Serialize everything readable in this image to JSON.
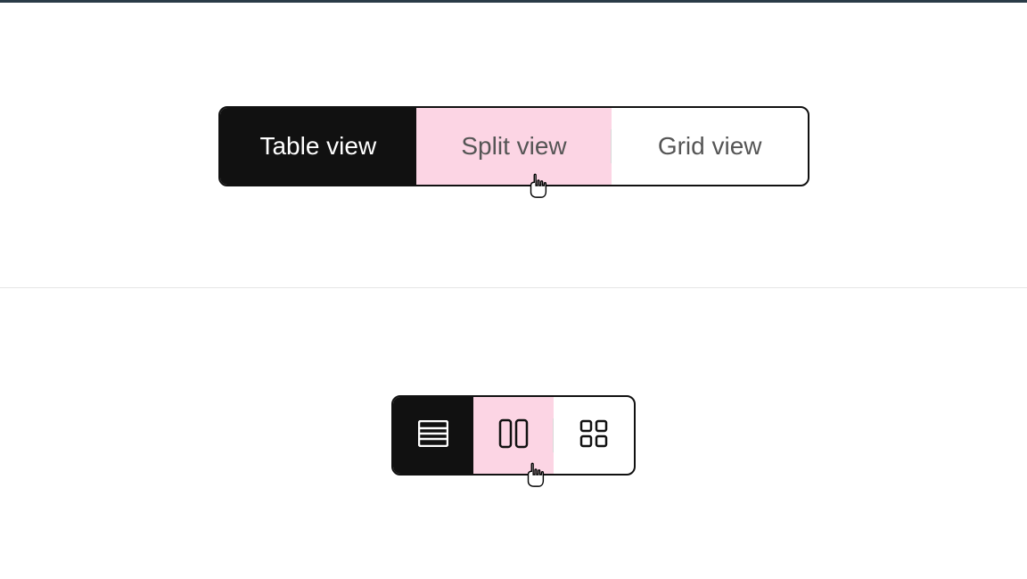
{
  "segmented_text": {
    "options": [
      {
        "label": "Table view",
        "state": "selected"
      },
      {
        "label": "Split view",
        "state": "hovered"
      },
      {
        "label": "Grid view",
        "state": "default"
      }
    ]
  },
  "segmented_icon": {
    "options": [
      {
        "icon": "table-view-icon",
        "state": "selected"
      },
      {
        "icon": "split-view-icon",
        "state": "hovered"
      },
      {
        "icon": "grid-view-icon",
        "state": "default"
      }
    ]
  }
}
